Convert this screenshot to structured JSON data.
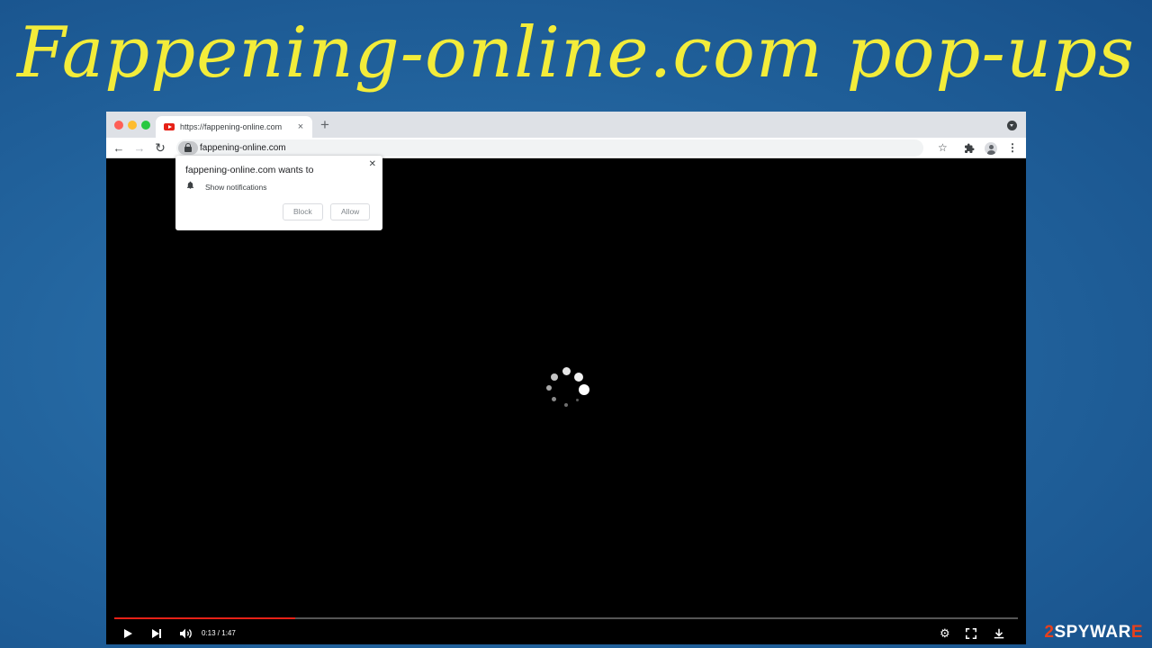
{
  "page": {
    "title": "Fappening-online.com pop-ups",
    "title_color": "#f3ec3a",
    "watermark": {
      "accent": "2",
      "main": "SPYWAR",
      "tail": "E"
    }
  },
  "browser": {
    "tab": {
      "title": "https://fappening-online.com",
      "favicon": "youtube-icon",
      "close": "×"
    },
    "new_tab": "+",
    "url": "fappening-online.com",
    "nav": {
      "back": "←",
      "forward": "→",
      "reload": "↻"
    },
    "icons": {
      "star": "☆",
      "extensions": "puzzle-icon",
      "menu": "⋮",
      "profile": "avatar-icon"
    }
  },
  "popup": {
    "title": "fappening-online.com wants to",
    "permission": "Show notifications",
    "close": "✕",
    "block_label": "Block",
    "allow_label": "Allow"
  },
  "player": {
    "time": "0:13 / 1:47",
    "progress": 0.2,
    "accent_color": "#e62117",
    "state": "loading"
  }
}
